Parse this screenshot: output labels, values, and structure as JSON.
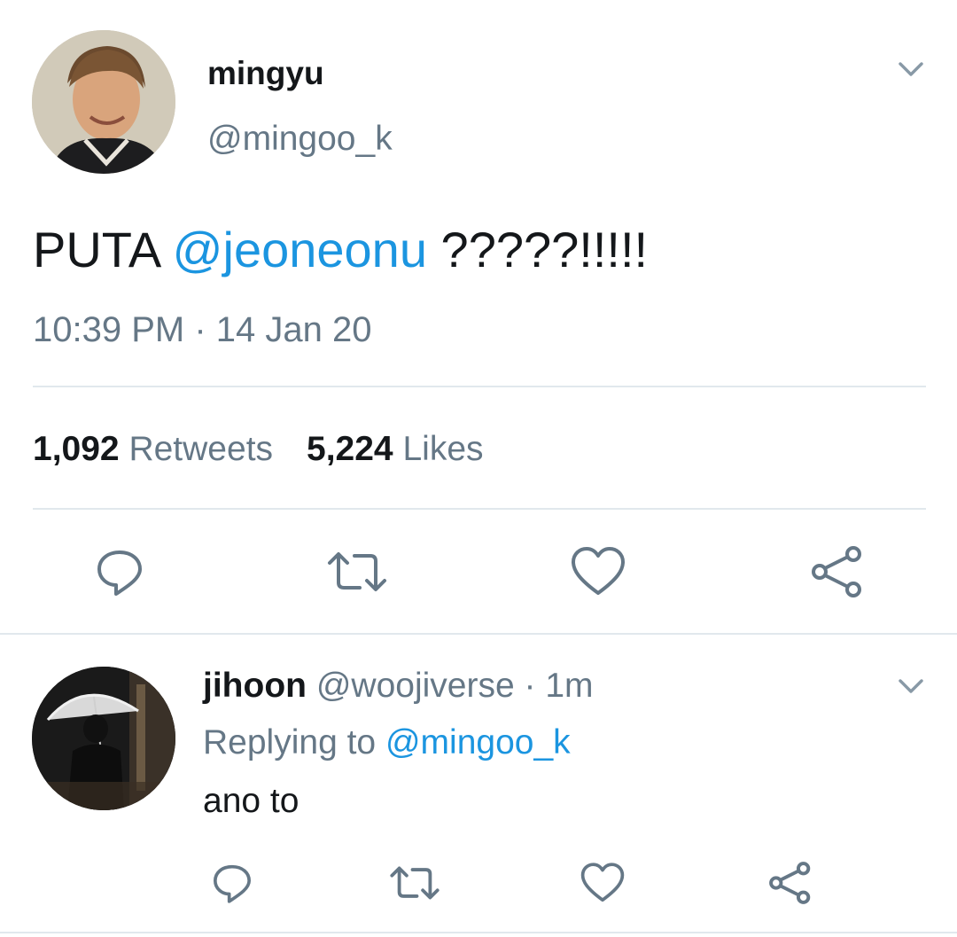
{
  "tweet": {
    "author_name": "mingyu",
    "author_handle": "@mingoo_k",
    "text_prefix": "PUTA ",
    "text_mention": "@jeoneonu",
    "text_suffix": " ?????!!!!!",
    "timestamp": "10:39 PM · 14 Jan 20",
    "retweets_count": "1,092",
    "retweets_label": "Retweets",
    "likes_count": "5,224",
    "likes_label": "Likes"
  },
  "reply": {
    "author_name": "jihoon",
    "author_handle": "@woojiverse",
    "separator": " · ",
    "time": "1m",
    "replying_prefix": "Replying to ",
    "replying_handle": "@mingoo_k",
    "text": "ano to"
  },
  "icons": {
    "caret": "chevron-down-icon",
    "reply": "reply-icon",
    "retweet": "retweet-icon",
    "like": "heart-icon",
    "share": "share-icon"
  },
  "colors": {
    "text": "#14171a",
    "secondary": "#657786",
    "link": "#1b95e0",
    "divider": "#e1e8ed"
  }
}
